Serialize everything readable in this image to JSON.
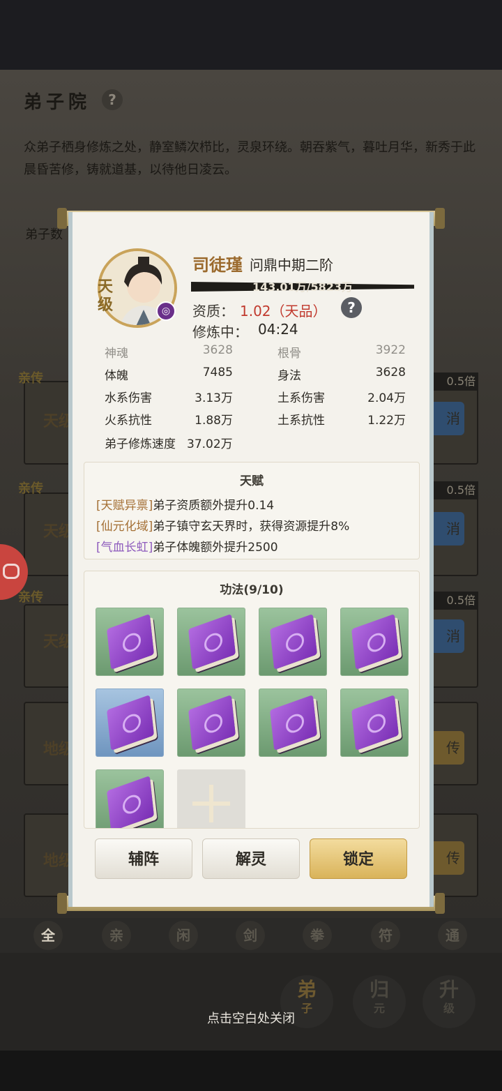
{
  "page": {
    "title": "弟子院",
    "description": "众弟子栖身修炼之处，静室鳞次栉比，灵泉环绕。朝吞紫气，暮吐月华，新秀于此晨昏苦修，铸就道基，以待他日凌云。",
    "count_label": "弟子数",
    "card_tags": [
      "亲传",
      "亲传",
      "亲传"
    ],
    "multiplier": "0.5倍",
    "card_ranks": [
      "天级",
      "天级",
      "天级",
      "地级",
      "地级"
    ],
    "card_button_labels": [
      "消",
      "消",
      "消",
      "传",
      "传"
    ],
    "filters": [
      "全",
      "亲",
      "闲",
      "剑",
      "拳",
      "符",
      "通"
    ],
    "nav": [
      {
        "main": "弟",
        "sub": "子"
      },
      {
        "main": "归",
        "sub": "元"
      },
      {
        "main": "升",
        "sub": "级"
      }
    ],
    "close_hint": "点击空白处关闭"
  },
  "disciple": {
    "name": "司徒瑾",
    "realm": "问鼎中期二阶",
    "rank": "天级",
    "progress_text": "143.01万/5823万",
    "progress_fraction": 0.0246,
    "qualification_label": "资质：",
    "qualification_value": "1.02（天品）",
    "training_label": "修炼中：",
    "training_value": "04:24"
  },
  "stats": {
    "rows": [
      {
        "l_label": "神魂",
        "l_value": "3628",
        "r_label": "根骨",
        "r_value": "3922"
      },
      {
        "l_label": "体魄",
        "l_value": "7485",
        "r_label": "身法",
        "r_value": "3628"
      },
      {
        "l_label": "水系伤害",
        "l_value": "3.13万",
        "r_label": "土系伤害",
        "r_value": "2.04万"
      },
      {
        "l_label": "火系抗性",
        "l_value": "1.88万",
        "r_label": "土系抗性",
        "r_value": "1.22万"
      }
    ],
    "speed_label": "弟子修炼速度",
    "speed_value": "37.02万"
  },
  "talents": {
    "title": "天赋",
    "items": [
      {
        "tag": "[天赋异禀]",
        "text": "弟子资质额外提升0.14"
      },
      {
        "tag": "[仙元化域]",
        "text": "弟子镇守玄天界时，获得资源提升8%"
      },
      {
        "tag": "[气血长虹]",
        "text": "弟子体魄额外提升2500"
      }
    ]
  },
  "skills": {
    "title": "功法(9/10)",
    "slot_colors": [
      "green",
      "green",
      "green",
      "green",
      "blue",
      "green",
      "green",
      "green",
      "green"
    ]
  },
  "buttons": {
    "assist": "辅阵",
    "release": "解灵",
    "lock": "锁定"
  }
}
